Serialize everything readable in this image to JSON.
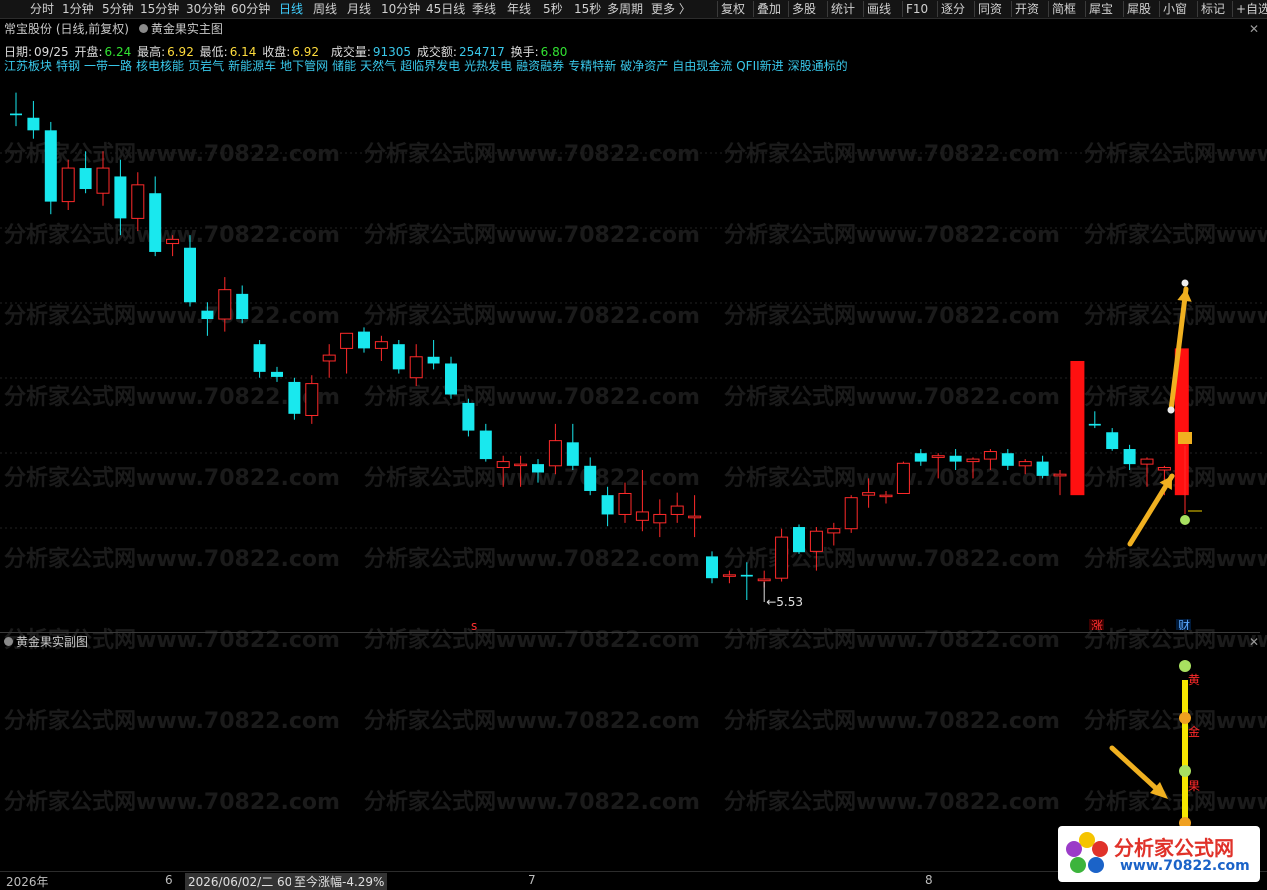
{
  "toolbar": {
    "left_items": [
      "分时",
      "1分钟",
      "5分钟",
      "15分钟",
      "30分钟",
      "60分钟",
      "日线",
      "周线",
      "月线",
      "10分钟",
      "45日线",
      "季线",
      "年线",
      "5秒",
      "15秒",
      "多周期",
      "更多 〉"
    ],
    "active": "日线",
    "right_items": [
      "复权",
      "叠加",
      "多股",
      "统计",
      "画线",
      "F10",
      "逐分",
      "同资",
      "开资",
      "简框",
      "犀宝",
      "犀股",
      "小窗",
      "标记",
      "+自选"
    ]
  },
  "main_chart": {
    "title": "常宝股份 (日线,前复权)",
    "indicator": "黄金果实主图",
    "info": {
      "date_label": "日期:",
      "date_value": "09/25",
      "open_label": "开盘:",
      "open_value": "6.24",
      "high_label": "最高:",
      "high_value": "6.92",
      "low_label": "最低:",
      "low_value": "6.14",
      "close_label": "收盘:",
      "close_value": "6.92",
      "vol_label": "成交量:",
      "vol_value": "91305",
      "amt_label": "成交额:",
      "amt_value": "254717",
      "turn_label": "换手:",
      "turn_value": "6.80"
    },
    "sectors": [
      "江苏板块",
      "特钢",
      "一带一路",
      "核电核能",
      "页岩气",
      "新能源车",
      "地下管网",
      "储能",
      "天然气",
      "超临界发电",
      "光热发电",
      "融资融券",
      "专精特新",
      "破净资产",
      "自由现金流",
      "QFII新进",
      "深股通标的"
    ],
    "low_marker": "5.53",
    "signals": {
      "s": "s",
      "zhang": "涨",
      "cai": "财"
    }
  },
  "sub_chart": {
    "title": "黄金果实副图",
    "labels": [
      "黄",
      "金",
      "果"
    ]
  },
  "bottom_axis": {
    "year": "2026年",
    "m6": "6",
    "cursor": "2026/06/02/二 60",
    "change": "至今涨幅-4.29%",
    "m7": "7",
    "m8": "8"
  },
  "logo": {
    "line1": "分析家公式网",
    "line2": "www.70822.com"
  },
  "watermark": "分析家公式网www.70822.com",
  "colors": {
    "up": "#ff2a2a",
    "down": "#19e8ee",
    "bg": "#000000",
    "accent": "#3fd0ff",
    "gold": "#f0b020"
  },
  "chart_data": {
    "type": "candlestick",
    "candles": [
      {
        "o": 8.5,
        "h": 8.75,
        "l": 8.35,
        "c": 8.48
      },
      {
        "o": 8.45,
        "h": 8.65,
        "l": 8.2,
        "c": 8.3
      },
      {
        "o": 8.3,
        "h": 8.4,
        "l": 7.3,
        "c": 7.45
      },
      {
        "o": 7.45,
        "h": 7.95,
        "l": 7.35,
        "c": 7.85
      },
      {
        "o": 7.85,
        "h": 8.05,
        "l": 7.55,
        "c": 7.6
      },
      {
        "o": 7.55,
        "h": 8.05,
        "l": 7.4,
        "c": 7.85
      },
      {
        "o": 7.75,
        "h": 7.95,
        "l": 7.05,
        "c": 7.25
      },
      {
        "o": 7.25,
        "h": 7.8,
        "l": 7.1,
        "c": 7.65
      },
      {
        "o": 7.55,
        "h": 7.75,
        "l": 6.8,
        "c": 6.85
      },
      {
        "o": 6.95,
        "h": 7.05,
        "l": 6.8,
        "c": 7.0
      },
      {
        "o": 6.9,
        "h": 7.05,
        "l": 6.2,
        "c": 6.25
      },
      {
        "o": 6.15,
        "h": 6.25,
        "l": 5.85,
        "c": 6.05
      },
      {
        "o": 6.05,
        "h": 6.55,
        "l": 5.9,
        "c": 6.4
      },
      {
        "o": 6.35,
        "h": 6.45,
        "l": 6.0,
        "c": 6.05
      },
      {
        "o": 5.75,
        "h": 5.8,
        "l": 5.35,
        "c": 5.42
      },
      {
        "o": 5.42,
        "h": 5.48,
        "l": 5.3,
        "c": 5.36
      },
      {
        "o": 5.3,
        "h": 5.35,
        "l": 4.85,
        "c": 4.92
      },
      {
        "o": 4.9,
        "h": 5.38,
        "l": 4.8,
        "c": 5.28
      },
      {
        "o": 5.55,
        "h": 5.75,
        "l": 5.35,
        "c": 5.62
      },
      {
        "o": 5.7,
        "h": 5.85,
        "l": 5.4,
        "c": 5.88
      },
      {
        "o": 5.9,
        "h": 5.95,
        "l": 5.65,
        "c": 5.7
      },
      {
        "o": 5.7,
        "h": 5.85,
        "l": 5.55,
        "c": 5.78
      },
      {
        "o": 5.75,
        "h": 5.8,
        "l": 5.4,
        "c": 5.45
      },
      {
        "o": 5.35,
        "h": 5.75,
        "l": 5.25,
        "c": 5.6
      },
      {
        "o": 5.6,
        "h": 5.8,
        "l": 5.45,
        "c": 5.52
      },
      {
        "o": 5.52,
        "h": 5.6,
        "l": 5.1,
        "c": 5.15
      },
      {
        "o": 5.05,
        "h": 5.1,
        "l": 4.65,
        "c": 4.72
      },
      {
        "o": 4.72,
        "h": 4.8,
        "l": 4.35,
        "c": 4.38
      },
      {
        "o": 4.28,
        "h": 4.42,
        "l": 4.05,
        "c": 4.35
      },
      {
        "o": 4.32,
        "h": 4.42,
        "l": 4.05,
        "c": 4.32
      },
      {
        "o": 4.32,
        "h": 4.38,
        "l": 4.1,
        "c": 4.22
      },
      {
        "o": 4.3,
        "h": 4.8,
        "l": 4.2,
        "c": 4.6
      },
      {
        "o": 4.58,
        "h": 4.8,
        "l": 4.25,
        "c": 4.3
      },
      {
        "o": 4.3,
        "h": 4.4,
        "l": 3.95,
        "c": 4.0
      },
      {
        "o": 3.95,
        "h": 4.05,
        "l": 3.58,
        "c": 3.72
      },
      {
        "o": 3.72,
        "h": 4.1,
        "l": 3.62,
        "c": 3.97
      },
      {
        "o": 3.65,
        "h": 4.25,
        "l": 3.52,
        "c": 3.75
      },
      {
        "o": 3.62,
        "h": 3.9,
        "l": 3.45,
        "c": 3.72
      },
      {
        "o": 3.72,
        "h": 3.98,
        "l": 3.62,
        "c": 3.82
      },
      {
        "o": 3.68,
        "h": 3.95,
        "l": 3.45,
        "c": 3.7
      },
      {
        "o": 3.22,
        "h": 3.28,
        "l": 2.9,
        "c": 2.96
      },
      {
        "o": 3.0,
        "h": 3.05,
        "l": 2.9,
        "c": 3.0
      },
      {
        "o": 3.0,
        "h": 3.15,
        "l": 2.7,
        "c": 2.98
      },
      {
        "o": 2.93,
        "h": 3.05,
        "l": 2.85,
        "c": 2.95
      },
      {
        "o": 2.96,
        "h": 3.55,
        "l": 2.92,
        "c": 3.45
      },
      {
        "o": 3.57,
        "h": 3.6,
        "l": 3.25,
        "c": 3.27
      },
      {
        "o": 3.28,
        "h": 3.57,
        "l": 3.05,
        "c": 3.52
      },
      {
        "o": 3.5,
        "h": 3.62,
        "l": 3.35,
        "c": 3.55
      },
      {
        "o": 3.55,
        "h": 3.95,
        "l": 3.5,
        "c": 3.92
      },
      {
        "o": 3.95,
        "h": 4.15,
        "l": 3.8,
        "c": 3.98
      },
      {
        "o": 3.95,
        "h": 4.0,
        "l": 3.85,
        "c": 3.95
      },
      {
        "o": 3.97,
        "h": 4.35,
        "l": 3.97,
        "c": 4.33
      },
      {
        "o": 4.45,
        "h": 4.5,
        "l": 4.3,
        "c": 4.35
      },
      {
        "o": 4.4,
        "h": 4.45,
        "l": 4.15,
        "c": 4.42
      },
      {
        "o": 4.42,
        "h": 4.5,
        "l": 4.25,
        "c": 4.35
      },
      {
        "o": 4.35,
        "h": 4.4,
        "l": 4.15,
        "c": 4.38
      },
      {
        "o": 4.38,
        "h": 4.5,
        "l": 4.25,
        "c": 4.47
      },
      {
        "o": 4.45,
        "h": 4.5,
        "l": 4.25,
        "c": 4.3
      },
      {
        "o": 4.3,
        "h": 4.38,
        "l": 4.2,
        "c": 4.35
      },
      {
        "o": 4.35,
        "h": 4.42,
        "l": 4.15,
        "c": 4.18
      },
      {
        "o": 4.18,
        "h": 4.25,
        "l": 3.95,
        "c": 4.2
      },
      {
        "o": 4.2,
        "h": 5.05,
        "l": 4.05,
        "c": 4.8
      },
      {
        "o": 4.8,
        "h": 4.95,
        "l": 4.75,
        "c": 4.78
      },
      {
        "o": 4.7,
        "h": 4.75,
        "l": 4.48,
        "c": 4.5
      },
      {
        "o": 4.5,
        "h": 4.55,
        "l": 4.25,
        "c": 4.32
      },
      {
        "o": 4.32,
        "h": 4.4,
        "l": 4.05,
        "c": 4.38
      },
      {
        "o": 4.25,
        "h": 4.3,
        "l": 3.95,
        "c": 4.28
      },
      {
        "o": 4.2,
        "h": 5.0,
        "l": 4.0,
        "c": 4.9
      }
    ],
    "low_label": "5.53",
    "ylim": [
      2.7,
      8.9
    ]
  }
}
